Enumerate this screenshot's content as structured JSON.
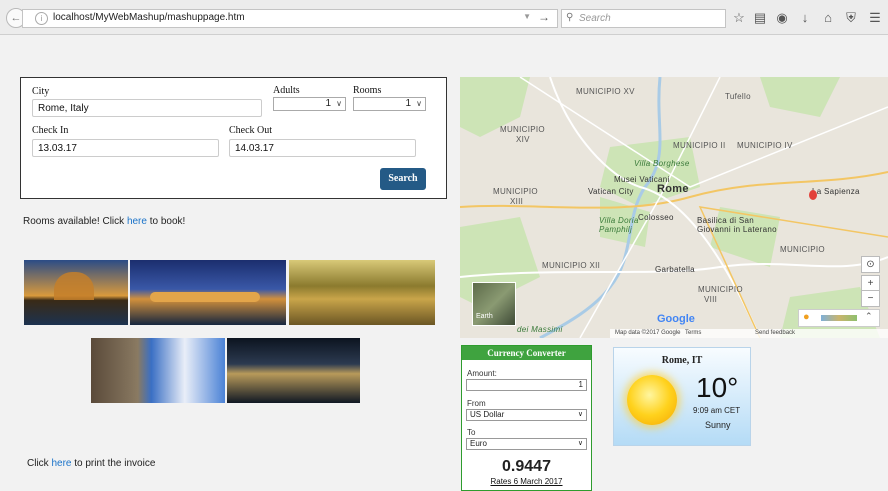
{
  "browser": {
    "url": "localhost/MyWebMashup/mashuppage.htm",
    "search_placeholder": "Search"
  },
  "booking": {
    "city_label": "City",
    "city_value": "Rome, Italy",
    "adults_label": "Adults",
    "adults_value": "1",
    "rooms_label": "Rooms",
    "rooms_value": "1",
    "checkin_label": "Check In",
    "checkin_value": "13.03.17",
    "checkout_label": "Check Out",
    "checkout_value": "14.03.17",
    "search_label": "Search"
  },
  "rooms": {
    "prefix": "Rooms available! Click ",
    "link": "here",
    "suffix": " to book!"
  },
  "invoice": {
    "prefix": "Click ",
    "link": "here",
    "suffix": " to print the invoice"
  },
  "map": {
    "labels": {
      "m15": "MUNICIPIO XV",
      "m2": "MUNICIPIO II",
      "m14a": "MUNICIPIO",
      "m14b": "XIV",
      "m4": "MUNICIPIO IV",
      "m13a": "MUNICIPIO",
      "m13b": "XIII",
      "m12": "MUNICIPIO XII",
      "m5": "MUNICIPIO",
      "m8a": "MUNICIPIO",
      "m8b": "VIII",
      "rome": "Rome",
      "vatican_museums": "Musei Vaticani",
      "vatican_city": "Vatican City",
      "borghese": "Villa Borghese",
      "colosseo": "Colosseo",
      "doria": "Villa Doria Pamphilj",
      "lateran": "Basilica di San Giovanni in Laterano",
      "sapienza": "La Sapienza",
      "tufello": "Tufello",
      "garbatella": "Garbatella",
      "massimi": "dei Massimi",
      "earth": "Earth",
      "google": "Google",
      "copyright": "Map data ©2017 Google",
      "terms": "Terms",
      "feedback": "Send feedback"
    }
  },
  "currency": {
    "title": "Currency Converter",
    "amount_label": "Amount:",
    "amount_value": "1",
    "from_label": "From",
    "from_value": "US Dollar",
    "to_label": "To",
    "to_value": "Euro",
    "result": "0.9447",
    "rates": "Rates 6 March 2017"
  },
  "weather": {
    "city": "Rome, IT",
    "temp": "10°",
    "time": "9:09 am CET",
    "condition": "Sunny"
  },
  "colors": {
    "search_button": "#245a86",
    "link": "#1a73c9",
    "converter_green": "#3fa33f"
  }
}
